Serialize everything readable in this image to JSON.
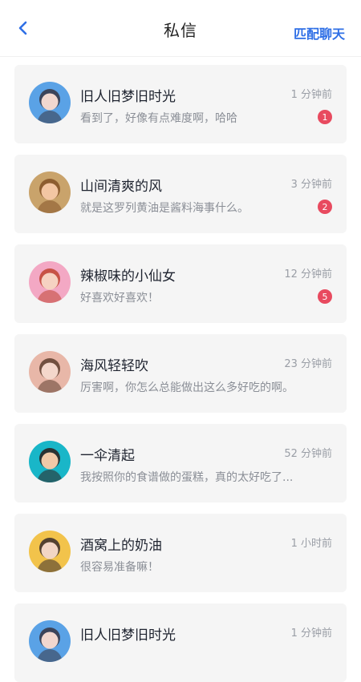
{
  "header": {
    "title": "私信",
    "right_action": "匹配聊天",
    "accent": "#2f6fe6"
  },
  "conversations": [
    {
      "name": "旧人旧梦旧时光",
      "preview": "看到了，好像有点难度啊，哈哈",
      "time": "1 分钟前",
      "badge": "1",
      "avatar_colors": [
        "#5aa2e6",
        "#3a3f52",
        "#f1d7cf"
      ]
    },
    {
      "name": "山间清爽的风",
      "preview": "就是这罗列黄油是酱料海事什么。",
      "time": "3 分钟前",
      "badge": "2",
      "avatar_colors": [
        "#c9a36b",
        "#8a5a2d",
        "#f3c6a3"
      ]
    },
    {
      "name": "辣椒味的小仙女",
      "preview": "好喜欢好喜欢！",
      "time": "12 分钟前",
      "badge": "5",
      "avatar_colors": [
        "#f3a8c4",
        "#c44d3f",
        "#f6d2c2"
      ]
    },
    {
      "name": "海风轻轻吹",
      "preview": "厉害啊，你怎么总能做出这么多好吃的啊。",
      "time": "23 分钟前",
      "badge": "",
      "avatar_colors": [
        "#e8b7a8",
        "#6b4a3a",
        "#f4d7cb"
      ]
    },
    {
      "name": "一伞清起",
      "preview": "我按照你的食谱做的蛋糕，真的太好吃了...",
      "time": "52 分钟前",
      "badge": "",
      "avatar_colors": [
        "#19b6c8",
        "#2b2b2b",
        "#f1c9a8"
      ]
    },
    {
      "name": "酒窝上的奶油",
      "preview": "很容易准备嘛！",
      "time": "1 小时前",
      "badge": "",
      "avatar_colors": [
        "#f2c34b",
        "#4a3b2e",
        "#f2d6c4"
      ]
    },
    {
      "name": "旧人旧梦旧时光",
      "preview": "",
      "time": "1 分钟前",
      "badge": "",
      "avatar_colors": [
        "#5aa2e6",
        "#3a3f52",
        "#f1d7cf"
      ]
    }
  ]
}
